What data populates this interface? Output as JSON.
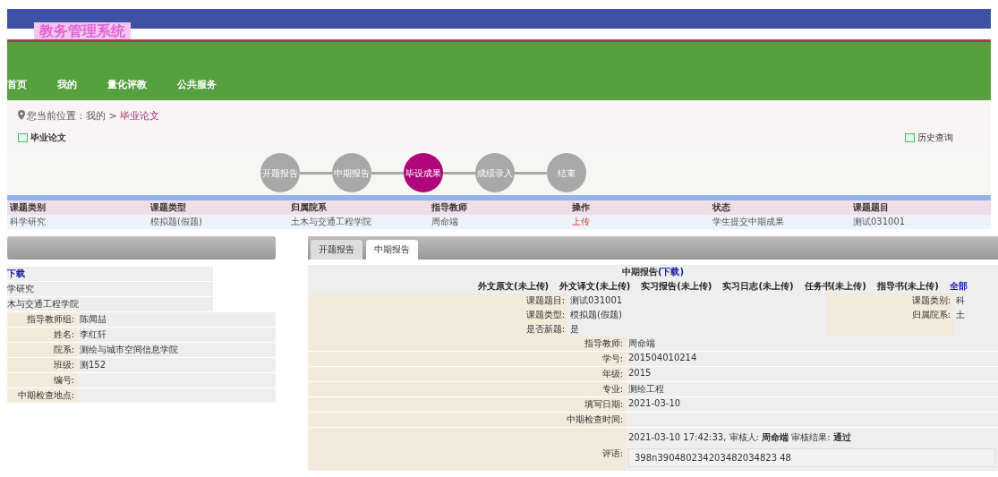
{
  "header": {
    "system_title": "教务管理系统"
  },
  "nav": [
    {
      "label": "首页"
    },
    {
      "label": "我的"
    },
    {
      "label": "量化评教"
    },
    {
      "label": "公共服务"
    }
  ],
  "breadcrumb": {
    "prefix": "您当前位置：我的 >",
    "current": "毕业论文"
  },
  "page_title": "毕业论文",
  "history_link": "历史查询",
  "steps": [
    {
      "label": "开题报告",
      "selected": false
    },
    {
      "label": "中期报告",
      "selected": false
    },
    {
      "label": "毕设成果",
      "selected": true
    },
    {
      "label": "成绩录入",
      "selected": false
    },
    {
      "label": "结束",
      "selected": false
    }
  ],
  "table": {
    "columns": [
      "课题类别",
      "课题类型",
      "归属院系",
      "指导教师",
      "操作",
      "状态",
      "课题题目"
    ],
    "rows": [
      [
        "科学研究",
        "模拟题(假题)",
        "土木与交通工程学院",
        "周命端",
        "上传",
        "学生提交中期成果",
        "测试031001"
      ]
    ]
  },
  "left_panel": {
    "download": "下载",
    "lines": [
      "学研究",
      "木与交通工程学院"
    ],
    "fields": [
      {
        "label": "指导教师组:",
        "value": "陈闻喆"
      },
      {
        "label": "姓名:",
        "value": "李红轩"
      },
      {
        "label": "院系:",
        "value": "测绘与城市空间信息学院"
      },
      {
        "label": "班级:",
        "value": "测152"
      },
      {
        "label": "编号:"
      },
      {
        "label": "中期检查地点:"
      }
    ]
  },
  "right_panel": {
    "tabs": [
      {
        "label": "开题报告",
        "selected": false
      },
      {
        "label": "中期报告",
        "selected": true
      }
    ],
    "report_title": "中期报告",
    "report_download": "(下载)",
    "files": [
      "外文原文(未上传)",
      "外文译文(未上传)",
      "实习报告(未上传)",
      "实习日志(未上传)",
      "任务书(未上传)",
      "指导书(未上传)"
    ],
    "all_download": "全部",
    "top_fields": [
      {
        "label": "课题题目:",
        "value": "测试031001",
        "side_label": "课题类别:",
        "side_value": "科"
      },
      {
        "label": "课题类型:",
        "value": "模拟题(假题)",
        "side_label": "归属院系:",
        "side_value": "土"
      },
      {
        "label": "是否新题:",
        "value": "是"
      }
    ],
    "fields": [
      {
        "label": "指导教师:",
        "value": "周命端"
      },
      {
        "label": "学号:",
        "value": "201504010214"
      },
      {
        "label": "年级:",
        "value": "2015"
      },
      {
        "label": "专业:",
        "value": "测绘工程"
      },
      {
        "label": "填写日期:",
        "value": "2021-03-10"
      },
      {
        "label": "中期检查时间:"
      }
    ],
    "review": {
      "label": "评语:",
      "line": "2021-03-10 17:42:33, 审核人: **周命端** 审核结果: **通过**",
      "comment": "398n390480234203482034823 48"
    }
  }
}
